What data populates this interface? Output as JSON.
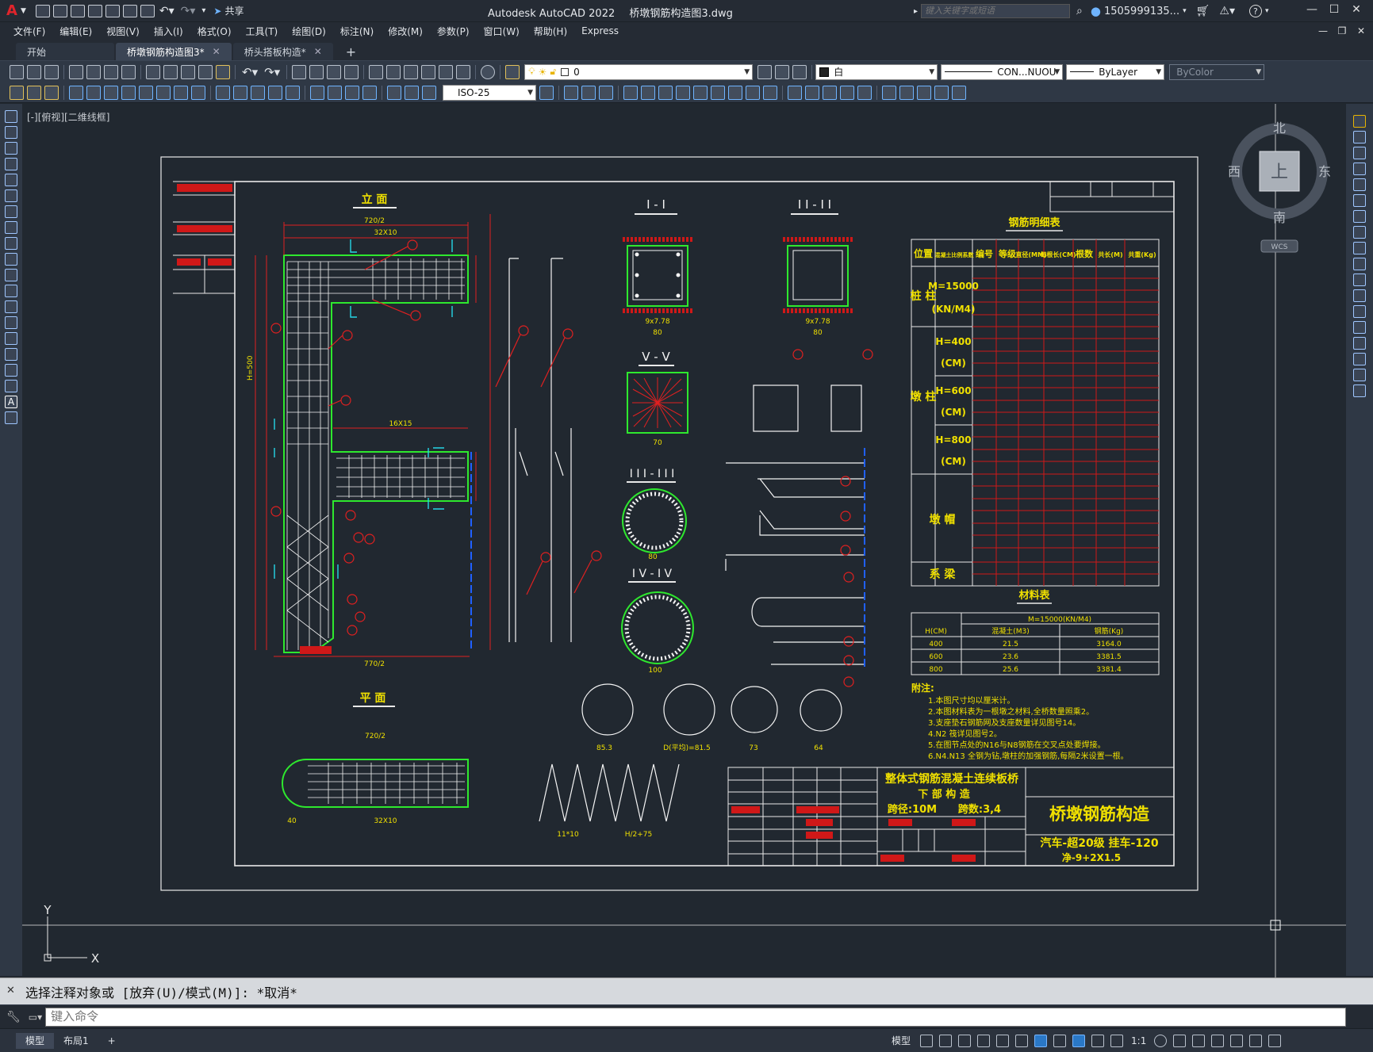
{
  "titlebar": {
    "app_name": "Autodesk AutoCAD 2022",
    "file_name": "桥墩钢筋构造图3.dwg",
    "share_label": "共享",
    "search_placeholder": "键入关键字或短语",
    "user_id": "1505999135...",
    "help_label": "?"
  },
  "menu": [
    "文件(F)",
    "编辑(E)",
    "视图(V)",
    "插入(I)",
    "格式(O)",
    "工具(T)",
    "绘图(D)",
    "标注(N)",
    "修改(M)",
    "参数(P)",
    "窗口(W)",
    "帮助(H)",
    "Express"
  ],
  "tabs": [
    {
      "label": "开始",
      "active": false,
      "closable": false
    },
    {
      "label": "桥墩钢筋构造图3*",
      "active": true,
      "closable": true
    },
    {
      "label": "桥头搭板构造*",
      "active": false,
      "closable": true
    }
  ],
  "toolbar": {
    "layer_value": "0",
    "color_value": "白",
    "linetype_value": "CON...NUOU",
    "lineweight_value": "ByLayer",
    "plotstyle_value": "ByColor",
    "dimstyle_value": "ISO-25"
  },
  "canvas": {
    "view_label": "[-][俯视][二维线框]",
    "compass": {
      "n": "北",
      "s": "南",
      "e": "东",
      "w": "西",
      "center": "上",
      "wcs": "WCS"
    },
    "ucs": {
      "x": "X",
      "y": "Y"
    }
  },
  "drawing": {
    "view_elevation": "立 面",
    "view_plan": "平 面",
    "sec1": "I - I",
    "sec2": "I I - I I",
    "sec3": "I I I - I I I",
    "sec4": "I V - I V",
    "sec5": "V - V",
    "dim_720_2": "720/2",
    "dim_32x10": "32X10",
    "dim_770_2": "770/2",
    "dim_16x15": "16X15",
    "dim_9x778": "9x7.78",
    "dim_80": "80",
    "dim_70": "70",
    "dim_100": "100",
    "dim_40": "40",
    "dim_11x10": "11*10",
    "dim_h2_75": "H/2+75",
    "dim_853": "85.3",
    "dim_d815": "D(平均)=81.5",
    "dim_73": "73",
    "dim_64": "64",
    "dim_h500": "H=500",
    "dim_h": "H",
    "table_title": "钢筋明细表",
    "table_headers": [
      "位置",
      "混凝土比例系数",
      "编号",
      "等级",
      "直径(MM)",
      "每根长(CM)",
      "根数",
      "共长(M)",
      "共重(Kg)"
    ],
    "group_pile": "桩 柱",
    "group_pier": "墩 柱",
    "group_cap": "墩 帽",
    "group_beam": "系 梁",
    "pile_m": "M=15000",
    "pile_unit": "(KN/M4)",
    "h400": "H=400",
    "h600": "H=600",
    "h800": "H=800",
    "cm": "(CM)",
    "material_title": "材料表",
    "material_m": "M=15000(KN/M4)",
    "material_cols": [
      "H(CM)",
      "混凝土(M3)",
      "钢筋(Kg)"
    ],
    "material_rows": [
      [
        "400",
        "21.5",
        "3164.0"
      ],
      [
        "600",
        "23.6",
        "3381.5"
      ],
      [
        "800",
        "25.6",
        "3381.4"
      ]
    ],
    "notes_title": "附注:",
    "notes": [
      "1.本图尺寸均以厘米计。",
      "2.本图材料表为一根墩之材料,全桥数量照乘2。",
      "3.支座垫石钢筋网及支座数量详见图号14。",
      "4.N2 筏详见图号2。",
      "5.在图节点处的N16与N8钢筋在交叉点处要焊接。",
      "6.N4.N13 全钢为钻,墩柱的加强钢筋,每隔2米设置一根。"
    ],
    "tb_project": "整体式钢筋混凝土连续板桥",
    "tb_sub": "下 部 构 造",
    "tb_span": "跨径:10M",
    "tb_spans": "跨数:3,4",
    "tb_title": "桥墩钢筋构造",
    "tb_load": "汽车-超20级  挂车-120",
    "tb_width": "净-9+2X1.5"
  },
  "command": {
    "history": "选择注释对象或 [放弃(U)/模式(M)]: *取消*",
    "input_placeholder": "键入命令"
  },
  "status": {
    "tabs": [
      {
        "label": "模型",
        "active": true
      },
      {
        "label": "布局1",
        "active": false
      }
    ],
    "add_tab": "+",
    "model_label": "模型",
    "scale": "1:1"
  }
}
